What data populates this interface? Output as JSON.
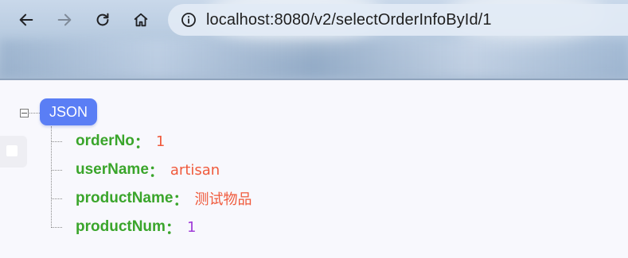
{
  "browser": {
    "url": "localhost:8080/v2/selectOrderInfoById/1",
    "buttons": {
      "back": "back-arrow-icon",
      "forward": "forward-arrow-icon",
      "reload": "reload-icon",
      "home": "home-icon"
    },
    "forward_enabled": false
  },
  "json_viewer": {
    "root_label": "JSON",
    "separator": "：",
    "fields": [
      {
        "key": "orderNo",
        "value": "1",
        "type": "number"
      },
      {
        "key": "userName",
        "value": "artisan",
        "type": "string"
      },
      {
        "key": "productName",
        "value": "测试物品",
        "type": "string"
      },
      {
        "key": "productNum",
        "value": "1",
        "type": "number"
      }
    ],
    "colors": {
      "root_badge": "#5a7ef5",
      "key": "#3aa52b",
      "string_value": "#f05a3c",
      "number_value": "#a03cd8"
    }
  }
}
